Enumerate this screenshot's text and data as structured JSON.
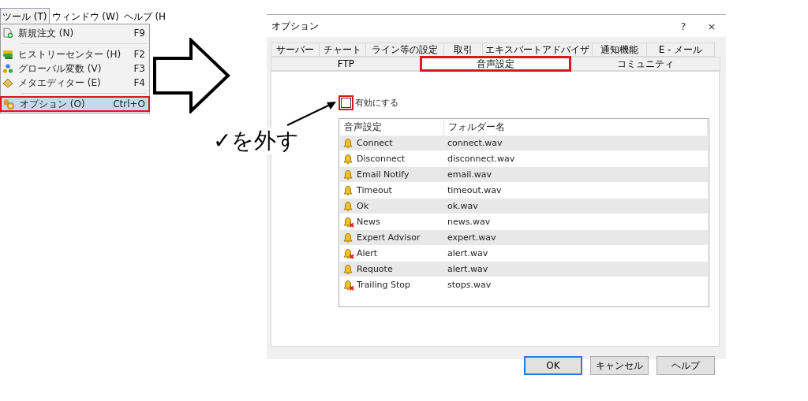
{
  "menu_bar": [
    {
      "label": "ツール (T)",
      "selected": true
    },
    {
      "label": "ウィンドウ (W)",
      "selected": false
    },
    {
      "label": "ヘルプ (H",
      "selected": false
    }
  ],
  "menu": {
    "items": [
      {
        "kind": "item",
        "label": "新規注文 (N)",
        "shortcut": "F9",
        "selected": false,
        "marked": false
      },
      {
        "kind": "separator"
      },
      {
        "kind": "item",
        "label": "ヒストリーセンター (H)",
        "shortcut": "F2",
        "selected": false,
        "marked": false
      },
      {
        "kind": "item",
        "label": "グローバル変数 (V)",
        "shortcut": "F3",
        "selected": false,
        "marked": false
      },
      {
        "kind": "item",
        "label": "メタエディター (E)",
        "shortcut": "F4",
        "selected": false,
        "marked": false
      },
      {
        "kind": "separator"
      },
      {
        "kind": "item",
        "label": "オプション (O)",
        "shortcut": "Ctrl+O",
        "selected": true,
        "marked": true
      }
    ]
  },
  "annotation": {
    "text": "✓を外す"
  },
  "dialog": {
    "title": "オプション",
    "help_button": "?",
    "close_button": "×",
    "tab_rows": [
      [
        {
          "label": "サーバー",
          "selected": false,
          "marked": false
        },
        {
          "label": "チャート",
          "selected": false,
          "marked": false
        },
        {
          "label": "ライン等の設定",
          "selected": false,
          "marked": false
        },
        {
          "label": "取引",
          "selected": false,
          "marked": false
        },
        {
          "label": "エキスパートアドバイザ",
          "selected": false,
          "marked": false
        },
        {
          "label": "通知機能",
          "selected": false,
          "marked": false
        },
        {
          "label": "E - メール",
          "selected": false,
          "marked": false
        }
      ],
      [
        {
          "label": "FTP",
          "selected": false,
          "marked": false
        },
        {
          "label": "音声設定",
          "selected": true,
          "marked": true
        },
        {
          "label": "コミュニティ",
          "selected": false,
          "marked": false
        }
      ]
    ],
    "enable": {
      "label": "有効にする",
      "checked": false,
      "marked": true
    },
    "table": {
      "columns": [
        "音声設定",
        "フォルダー名"
      ],
      "rows": [
        {
          "event": "Connect",
          "file": "connect.wav",
          "enabled": true
        },
        {
          "event": "Disconnect",
          "file": "disconnect.wav",
          "enabled": true
        },
        {
          "event": "Email Notify",
          "file": "email.wav",
          "enabled": true
        },
        {
          "event": "Timeout",
          "file": "timeout.wav",
          "enabled": true
        },
        {
          "event": "Ok",
          "file": "ok.wav",
          "enabled": true
        },
        {
          "event": "News",
          "file": "news.wav",
          "enabled": false
        },
        {
          "event": "Expert Advisor",
          "file": "expert.wav",
          "enabled": true
        },
        {
          "event": "Alert",
          "file": "alert.wav",
          "enabled": false
        },
        {
          "event": "Requote",
          "file": "alert.wav",
          "enabled": true
        },
        {
          "event": "Trailing Stop",
          "file": "stops.wav",
          "enabled": false
        }
      ]
    },
    "buttons": [
      {
        "label": "OK",
        "default": true
      },
      {
        "label": "キャンセル",
        "default": false
      },
      {
        "label": "ヘルプ",
        "default": false
      }
    ]
  }
}
